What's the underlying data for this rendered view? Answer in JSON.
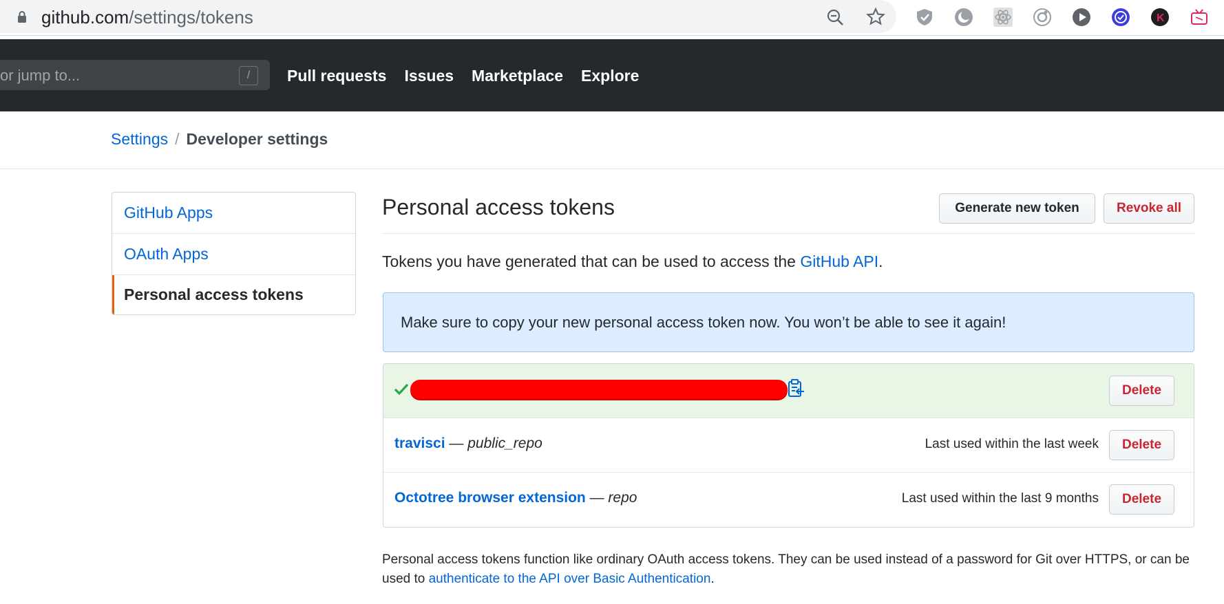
{
  "browser": {
    "url_domain": "github.com",
    "url_path": "/settings/tokens"
  },
  "header": {
    "search_placeholder": "or jump to...",
    "slash_key": "/",
    "nav": [
      "Pull requests",
      "Issues",
      "Marketplace",
      "Explore"
    ]
  },
  "breadcrumb": {
    "parent": "Settings",
    "separator": "/",
    "current": "Developer settings"
  },
  "sidebar": {
    "items": [
      {
        "label": "GitHub Apps"
      },
      {
        "label": "OAuth Apps"
      },
      {
        "label": "Personal access tokens"
      }
    ]
  },
  "main": {
    "title": "Personal access tokens",
    "generate_button": "Generate new token",
    "revoke_button": "Revoke all",
    "intro_text": "Tokens you have generated that can be used to access the ",
    "intro_link": "GitHub API",
    "intro_end": ".",
    "flash_message": "Make sure to copy your new personal access token now. You won’t be able to see it again!",
    "tokens": [
      {
        "name": "travisci",
        "separator": " — ",
        "scope": "public_repo",
        "last_used": "Last used within the last week",
        "delete": "Delete"
      },
      {
        "name": "Octotree browser extension",
        "separator": " — ",
        "scope": "repo",
        "last_used": "Last used within the last 9 months",
        "delete": "Delete"
      }
    ],
    "new_token_delete": "Delete",
    "footnote_text": "Personal access tokens function like ordinary OAuth access tokens. They can be used instead of a password for Git over HTTPS, or can be used to ",
    "footnote_link": "authenticate to the API over Basic Authentication",
    "footnote_end": "."
  },
  "colors": {
    "header_bg": "#24292e",
    "link": "#0366d6",
    "danger": "#cb2431",
    "flash_bg": "#dbedff",
    "new_token_bg": "#e9f6e6",
    "selected_accent": "#e36209",
    "redaction": "#ff0000"
  },
  "icons": [
    "lock-icon",
    "zoom-out-icon",
    "star-icon",
    "check-icon",
    "clipboard-icon"
  ]
}
